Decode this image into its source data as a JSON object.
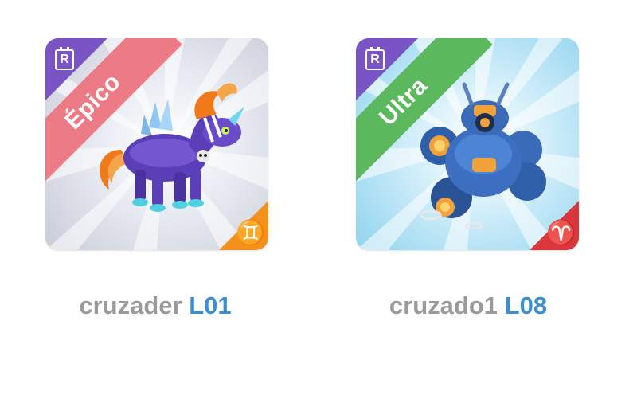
{
  "cards": [
    {
      "rarity_letter": "R",
      "tier_label": "Épico",
      "tier_color": "#ec7b86",
      "sign_symbol": "♊",
      "sign_color": "#f2911b",
      "creature": "purple-pony-icon",
      "name": "cruzader",
      "level": "L01"
    },
    {
      "rarity_letter": "R",
      "tier_label": "Ultra",
      "tier_color": "#5cb85c",
      "sign_symbol": "♈",
      "sign_color": "#d9363e",
      "creature": "blue-robot-icon",
      "name": "cruzado1",
      "level": "L08"
    }
  ],
  "colors": {
    "name_text": "#9a9a9a",
    "level_text": "#3a8fd0",
    "rarity_corner": "#7a53c4"
  }
}
